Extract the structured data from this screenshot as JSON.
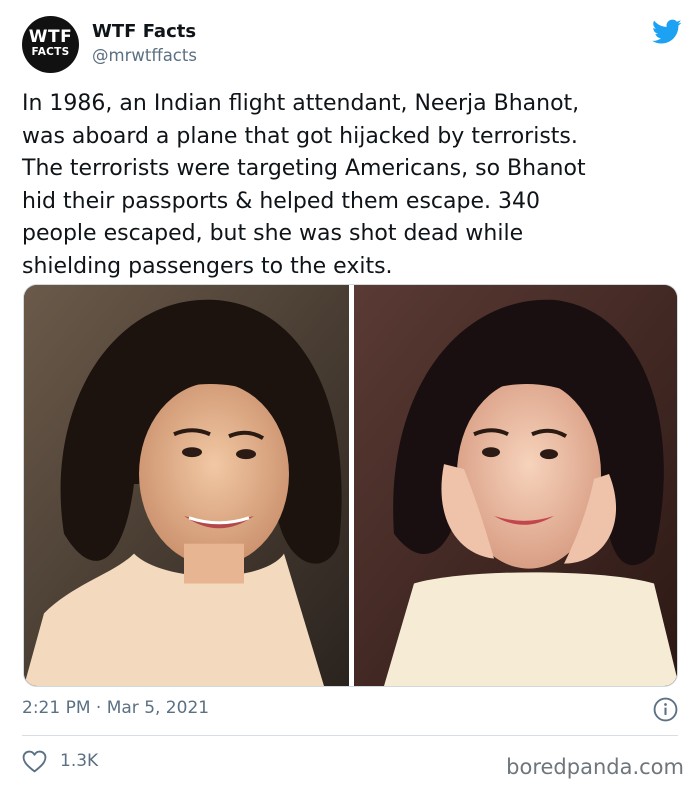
{
  "author": {
    "avatar_line1": "WTF",
    "avatar_line2": "FACTS",
    "name": "WTF Facts",
    "handle": "@mrwtffacts"
  },
  "tweet": {
    "text": "In 1986, an Indian flight attendant, Neerja Bhanot,\nwas aboard a plane that got hijacked by terrorists.\nThe terrorists were targeting Americans, so Bhanot\nhid their passports & helped them escape. 340\npeople escaped, but she was shot dead while\nshielding passengers to the exits.",
    "timestamp": "2:21 PM · Mar 5, 2021",
    "likes": "1.3K"
  },
  "icons": {
    "brand": "twitter-bird-icon",
    "info": "info-icon",
    "like": "heart-icon"
  },
  "colors": {
    "twitter_blue": "#1da1f2",
    "secondary_text": "#5b7083",
    "border": "#cfd9de"
  },
  "watermark": "boredpanda.com"
}
